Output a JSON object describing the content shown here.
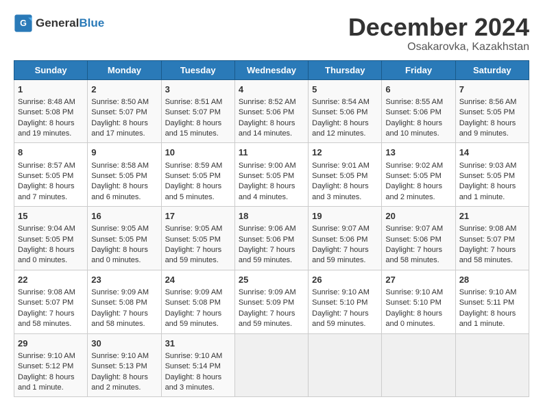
{
  "header": {
    "logo_line1": "General",
    "logo_line2": "Blue",
    "month": "December 2024",
    "location": "Osakarovka, Kazakhstan"
  },
  "days_of_week": [
    "Sunday",
    "Monday",
    "Tuesday",
    "Wednesday",
    "Thursday",
    "Friday",
    "Saturday"
  ],
  "weeks": [
    [
      {
        "day": 1,
        "sunrise": "8:48 AM",
        "sunset": "5:08 PM",
        "daylight": "8 hours and 19 minutes."
      },
      {
        "day": 2,
        "sunrise": "8:50 AM",
        "sunset": "5:07 PM",
        "daylight": "8 hours and 17 minutes."
      },
      {
        "day": 3,
        "sunrise": "8:51 AM",
        "sunset": "5:07 PM",
        "daylight": "8 hours and 15 minutes."
      },
      {
        "day": 4,
        "sunrise": "8:52 AM",
        "sunset": "5:06 PM",
        "daylight": "8 hours and 14 minutes."
      },
      {
        "day": 5,
        "sunrise": "8:54 AM",
        "sunset": "5:06 PM",
        "daylight": "8 hours and 12 minutes."
      },
      {
        "day": 6,
        "sunrise": "8:55 AM",
        "sunset": "5:06 PM",
        "daylight": "8 hours and 10 minutes."
      },
      {
        "day": 7,
        "sunrise": "8:56 AM",
        "sunset": "5:05 PM",
        "daylight": "8 hours and 9 minutes."
      }
    ],
    [
      {
        "day": 8,
        "sunrise": "8:57 AM",
        "sunset": "5:05 PM",
        "daylight": "8 hours and 7 minutes."
      },
      {
        "day": 9,
        "sunrise": "8:58 AM",
        "sunset": "5:05 PM",
        "daylight": "8 hours and 6 minutes."
      },
      {
        "day": 10,
        "sunrise": "8:59 AM",
        "sunset": "5:05 PM",
        "daylight": "8 hours and 5 minutes."
      },
      {
        "day": 11,
        "sunrise": "9:00 AM",
        "sunset": "5:05 PM",
        "daylight": "8 hours and 4 minutes."
      },
      {
        "day": 12,
        "sunrise": "9:01 AM",
        "sunset": "5:05 PM",
        "daylight": "8 hours and 3 minutes."
      },
      {
        "day": 13,
        "sunrise": "9:02 AM",
        "sunset": "5:05 PM",
        "daylight": "8 hours and 2 minutes."
      },
      {
        "day": 14,
        "sunrise": "9:03 AM",
        "sunset": "5:05 PM",
        "daylight": "8 hours and 1 minute."
      }
    ],
    [
      {
        "day": 15,
        "sunrise": "9:04 AM",
        "sunset": "5:05 PM",
        "daylight": "8 hours and 0 minutes."
      },
      {
        "day": 16,
        "sunrise": "9:05 AM",
        "sunset": "5:05 PM",
        "daylight": "8 hours and 0 minutes."
      },
      {
        "day": 17,
        "sunrise": "9:05 AM",
        "sunset": "5:05 PM",
        "daylight": "7 hours and 59 minutes."
      },
      {
        "day": 18,
        "sunrise": "9:06 AM",
        "sunset": "5:06 PM",
        "daylight": "7 hours and 59 minutes."
      },
      {
        "day": 19,
        "sunrise": "9:07 AM",
        "sunset": "5:06 PM",
        "daylight": "7 hours and 59 minutes."
      },
      {
        "day": 20,
        "sunrise": "9:07 AM",
        "sunset": "5:06 PM",
        "daylight": "7 hours and 58 minutes."
      },
      {
        "day": 21,
        "sunrise": "9:08 AM",
        "sunset": "5:07 PM",
        "daylight": "7 hours and 58 minutes."
      }
    ],
    [
      {
        "day": 22,
        "sunrise": "9:08 AM",
        "sunset": "5:07 PM",
        "daylight": "7 hours and 58 minutes."
      },
      {
        "day": 23,
        "sunrise": "9:09 AM",
        "sunset": "5:08 PM",
        "daylight": "7 hours and 58 minutes."
      },
      {
        "day": 24,
        "sunrise": "9:09 AM",
        "sunset": "5:08 PM",
        "daylight": "7 hours and 59 minutes."
      },
      {
        "day": 25,
        "sunrise": "9:09 AM",
        "sunset": "5:09 PM",
        "daylight": "7 hours and 59 minutes."
      },
      {
        "day": 26,
        "sunrise": "9:10 AM",
        "sunset": "5:10 PM",
        "daylight": "7 hours and 59 minutes."
      },
      {
        "day": 27,
        "sunrise": "9:10 AM",
        "sunset": "5:10 PM",
        "daylight": "8 hours and 0 minutes."
      },
      {
        "day": 28,
        "sunrise": "9:10 AM",
        "sunset": "5:11 PM",
        "daylight": "8 hours and 1 minute."
      }
    ],
    [
      {
        "day": 29,
        "sunrise": "9:10 AM",
        "sunset": "5:12 PM",
        "daylight": "8 hours and 1 minute."
      },
      {
        "day": 30,
        "sunrise": "9:10 AM",
        "sunset": "5:13 PM",
        "daylight": "8 hours and 2 minutes."
      },
      {
        "day": 31,
        "sunrise": "9:10 AM",
        "sunset": "5:14 PM",
        "daylight": "8 hours and 3 minutes."
      },
      null,
      null,
      null,
      null
    ]
  ]
}
